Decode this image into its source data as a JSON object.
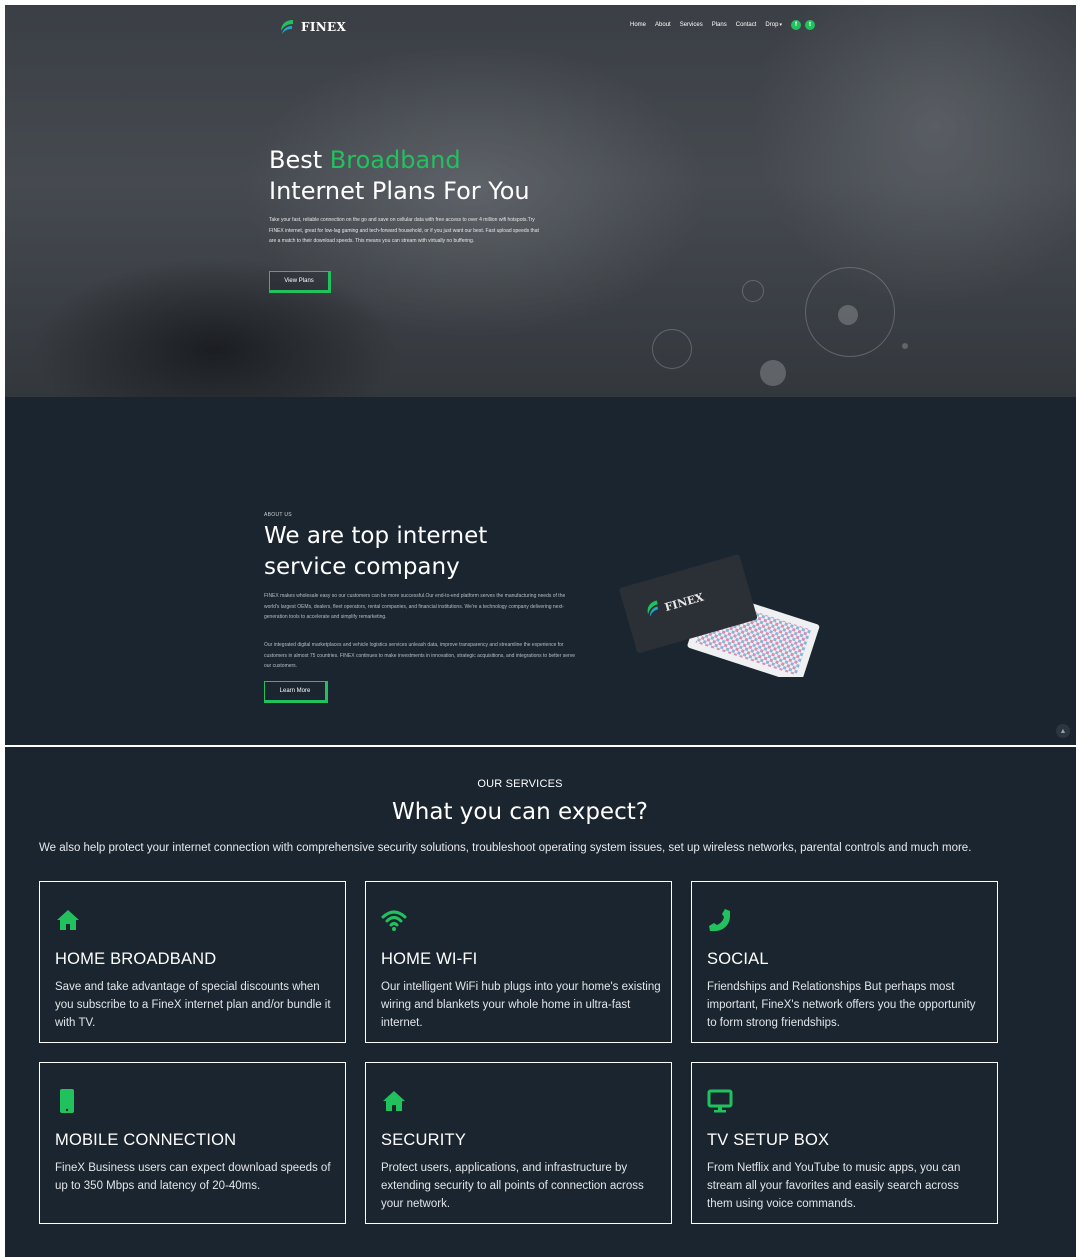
{
  "nav": {
    "brand": "FINEX",
    "links": [
      "Home",
      "About",
      "Services",
      "Plans",
      "Contact",
      "Drop"
    ],
    "social": [
      "f",
      "t"
    ]
  },
  "hero": {
    "title_part1": "Best ",
    "title_accent": "Broadband",
    "title_part2": "Internet Plans For You",
    "text": "Take your fast, reliable connection on the go and save on cellular data with free access to over 4 million wifi hotspots.Try FINEX internet, great for low-lag gaming and tech-forward household, or if you just want our best. Fast upload speeds that are a match to their download speeds. This means you can stream with virtually no buffering.",
    "button": "View Plans"
  },
  "about": {
    "eyebrow": "ABOUT US",
    "title_line1": "We are top internet",
    "title_line2": "service company",
    "p1": "FINEX makes wholesale easy so our customers can be more successful.Our end-to-end platform serves the manufacturing needs of the world's largest OEMs, dealers, fleet operators, rental companies, and financial institutions. We're a technology company delivering next-generation tools to accelerate and simplify remarketing.",
    "p2": "Our integrated digital marketplaces and vehicle logistics services unleash data, improve transparency and streamline the experience for customers in almost 75 countries. FINEX continues to make investments in innovation, strategic acquisitions, and integrations to better serve our customers.",
    "button": "Learn More",
    "card_brand": "FINEX"
  },
  "services": {
    "eyebrow": "OUR SERVICES",
    "title": "What you can expect?",
    "description": "We also help protect your internet connection with comprehensive security solutions, troubleshoot operating system issues, set up wireless networks, parental controls and much more.",
    "accent_color": "#21c25e",
    "items": [
      {
        "icon": "home-icon",
        "title": "HOME BROADBAND",
        "text": "Save and take advantage of special discounts when you subscribe to a FineX internet plan and/or bundle it with TV."
      },
      {
        "icon": "wifi-icon",
        "title": "HOME WI-FI",
        "text": "Our intelligent WiFi hub plugs into your home's existing wiring and blankets your whole home in ultra-fast internet."
      },
      {
        "icon": "phone-icon",
        "title": "SOCIAL",
        "text": "Friendships and Relationships But perhaps most important, FineX's network offers you the opportunity to form strong friendships."
      },
      {
        "icon": "mobile-icon",
        "title": "MOBILE CONNECTION",
        "text": "FineX Business users can expect download speeds of up to 350 Mbps and latency of 20-40ms."
      },
      {
        "icon": "home-icon",
        "title": "SECURITY",
        "text": "Protect users, applications, and infrastructure by extending security to all points of connection across your network."
      },
      {
        "icon": "desktop-icon",
        "title": "TV SETUP BOX",
        "text": "From Netflix and YouTube to music apps, you can stream all your favorites and easily search across them using voice commands."
      }
    ]
  }
}
